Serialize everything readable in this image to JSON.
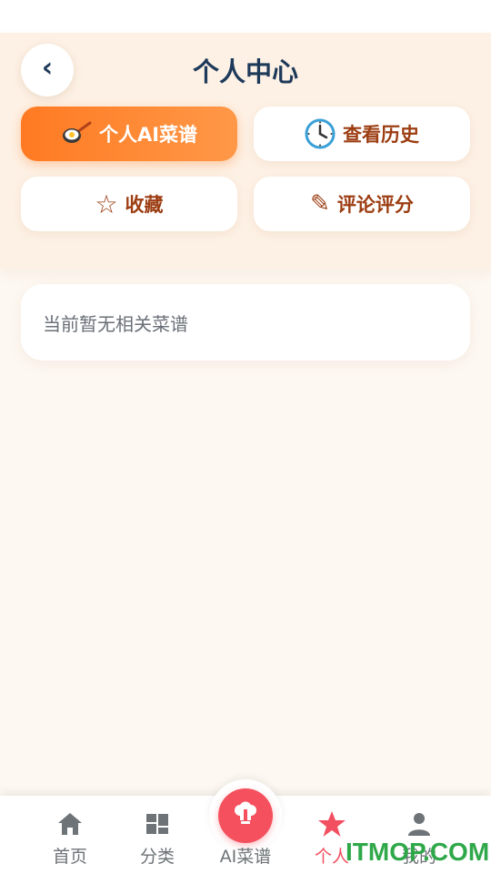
{
  "header": {
    "title": "个人中心",
    "back_icon": "chevron-left-icon",
    "back_glyph": "‹"
  },
  "menu": {
    "ai_recipes": {
      "label": "个人AI菜谱",
      "icon": "frying-pan-icon",
      "active": true
    },
    "history": {
      "label": "查看历史",
      "icon": "clock-icon"
    },
    "favorites": {
      "label": "收藏",
      "icon": "star-outline-icon",
      "glyph": "☆"
    },
    "reviews": {
      "label": "评论评分",
      "icon": "pencil-icon",
      "glyph": "✎"
    }
  },
  "main": {
    "empty_message": "当前暂无相关菜谱"
  },
  "tabbar": {
    "items": [
      {
        "label": "首页",
        "icon": "home-icon"
      },
      {
        "label": "分类",
        "icon": "grid-icon"
      },
      {
        "label": "AI菜谱",
        "icon": "chef-icon"
      },
      {
        "label": "个人",
        "icon": "star-icon",
        "active": true
      },
      {
        "label": "我的",
        "icon": "user-icon"
      }
    ]
  },
  "watermark": "ITMOP.COM",
  "colors": {
    "accent": "#ff7a22",
    "title": "#1e3a5a",
    "menu_text": "#9c3d12",
    "tab_active": "#f25061"
  }
}
